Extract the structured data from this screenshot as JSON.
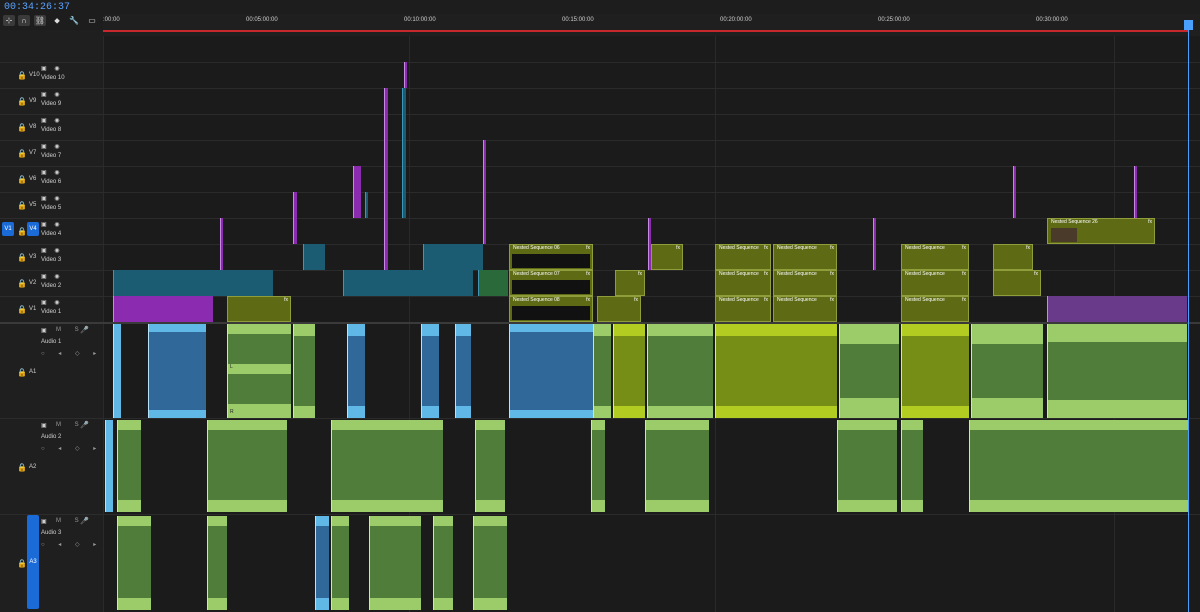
{
  "timecode": "00:34:26:37",
  "toolbar": {
    "tools": [
      {
        "name": "insert-and-overwrite-sequences-as-nests-icon",
        "glyph": "⊹"
      },
      {
        "name": "snap-icon",
        "glyph": "∩"
      },
      {
        "name": "linked-selection-icon",
        "glyph": "⛓"
      },
      {
        "name": "add-marker-icon",
        "glyph": "⬥"
      },
      {
        "name": "timeline-display-settings-icon",
        "glyph": "🔧"
      },
      {
        "name": "captions-icon",
        "glyph": "▭"
      }
    ]
  },
  "ruler": {
    "ticks": [
      ":00:00",
      "00:05:00:00",
      "00:10:00:00",
      "00:15:00:00",
      "00:20:00:00",
      "00:25:00:00",
      "00:30:00:00"
    ]
  },
  "video_tracks": [
    {
      "id": "V10",
      "name": "Video 10"
    },
    {
      "id": "V9",
      "name": "Video 9"
    },
    {
      "id": "V8",
      "name": "Video 8"
    },
    {
      "id": "V7",
      "name": "Video 7"
    },
    {
      "id": "V6",
      "name": "Video 6"
    },
    {
      "id": "V5",
      "name": "Video 5"
    },
    {
      "id": "V4",
      "name": "Video 4",
      "source": "V1"
    },
    {
      "id": "V3",
      "name": "Video 3"
    },
    {
      "id": "V2",
      "name": "Video 2"
    },
    {
      "id": "V1",
      "name": "Video 1"
    }
  ],
  "audio_tracks": [
    {
      "id": "A1",
      "name": "Audio 1",
      "controls": "M S",
      "source": ""
    },
    {
      "id": "A2",
      "name": "Audio 2",
      "controls": "M S",
      "source": ""
    },
    {
      "id": "A3",
      "name": "Audio 3",
      "controls": "M S",
      "source": "A3"
    }
  ],
  "nested_clips": {
    "v4_a": "Nested Sequence 26",
    "v3_a": "Nested Sequence 06",
    "v2_a": "Nested Sequence 07",
    "v1_a": "Nested Sequence 08",
    "generic": "Nested Sequence",
    "fx": "fx"
  },
  "audio_channel_labels": {
    "left": "L",
    "right": "R"
  },
  "colors": {
    "playhead": "#4aa0ff",
    "video_purple": "#8a2bb0",
    "video_teal": "#1b5c72",
    "nested_olive": "#5e6a14",
    "audio_green": "#9ccc6a",
    "audio_blue": "#5fb8e6",
    "audio_lime": "#b3cc22",
    "work_area": "#c8282d"
  }
}
